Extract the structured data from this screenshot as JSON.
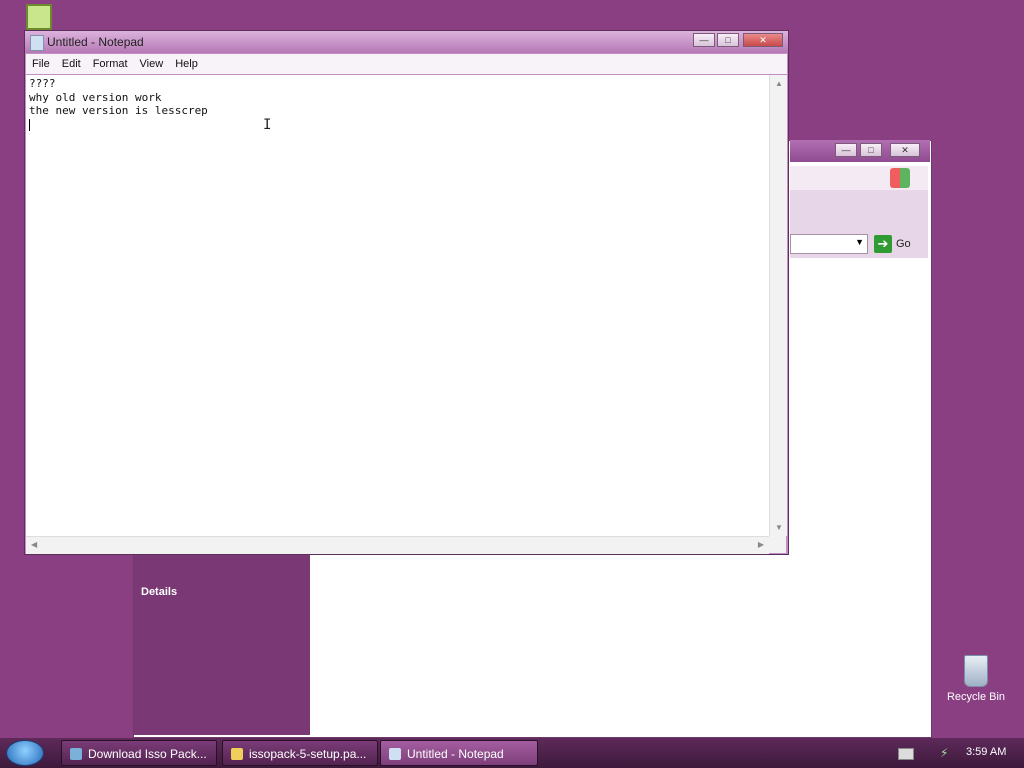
{
  "notepad": {
    "title": "Untitled - Notepad",
    "menu": [
      "File",
      "Edit",
      "Format",
      "View",
      "Help"
    ],
    "lines": [
      "????",
      "why old version work",
      "the new version is lesscrep"
    ],
    "controls": {
      "minimize": "—",
      "maximize": "□",
      "close": "✕"
    }
  },
  "background_window": {
    "go_label": "Go",
    "sidebar_heading": "Details"
  },
  "desktop": {
    "recycle_bin_label": "Recycle Bin"
  },
  "taskbar": {
    "tasks": [
      {
        "label": "Download Isso Pack...",
        "icon": "globe-icon"
      },
      {
        "label": "issopack-5-setup.pa...",
        "icon": "folder-icon"
      },
      {
        "label": "Untitled - Notepad",
        "icon": "notepad-icon",
        "active": true
      }
    ],
    "clock": "3:59 AM"
  },
  "colors": {
    "desktop": "#8a3f82",
    "taskbar": "#4a1f48",
    "notepad_title": "#c48ec4"
  }
}
